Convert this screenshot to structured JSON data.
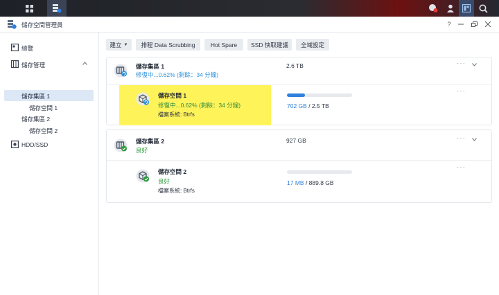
{
  "app": {
    "title": "儲存空間管理員"
  },
  "window_controls": {
    "help": "?"
  },
  "sidebar": {
    "items": [
      {
        "label": "總覽"
      },
      {
        "label": "儲存管理"
      },
      {
        "label": "儲存集區 1"
      },
      {
        "label": "儲存空間 1"
      },
      {
        "label": "儲存集區 2"
      },
      {
        "label": "儲存空間 2"
      },
      {
        "label": "HDD/SSD"
      }
    ]
  },
  "toolbar": {
    "create_label": "建立",
    "scrubbing_label": "排程 Data Scrubbing",
    "hotspare_label": "Hot Spare",
    "ssd_cache_label": "SSD 快取建議",
    "global_settings_label": "全域設定"
  },
  "pools": [
    {
      "name": "儲存集區 1",
      "status": "修復中...0.62% (剩餘：34 分鐘)",
      "size": "2.6 TB",
      "volume": {
        "name": "儲存空間 1",
        "status": "修復中...0.62% (剩餘：34 分鐘)",
        "filesystem": "檔案系統: Btrfs",
        "used": "702 GB",
        "total": "/ 2.5 TB",
        "usage_fraction": 0.28
      }
    },
    {
      "name": "儲存集區 2",
      "status": "良好",
      "size": "927 GB",
      "volume": {
        "name": "儲存空間 2",
        "status": "良好",
        "filesystem": "檔案系統: Btrfs",
        "used": "17 MB",
        "total": "/ 889.8 GB",
        "usage_fraction": 0.0
      }
    }
  ],
  "colors": {
    "accent": "#2f80dd",
    "warning_text": "#2b8fd9",
    "ok_text": "#2e9a3b",
    "highlight": "#fff35a",
    "selected_nav": "#dde8f6"
  }
}
